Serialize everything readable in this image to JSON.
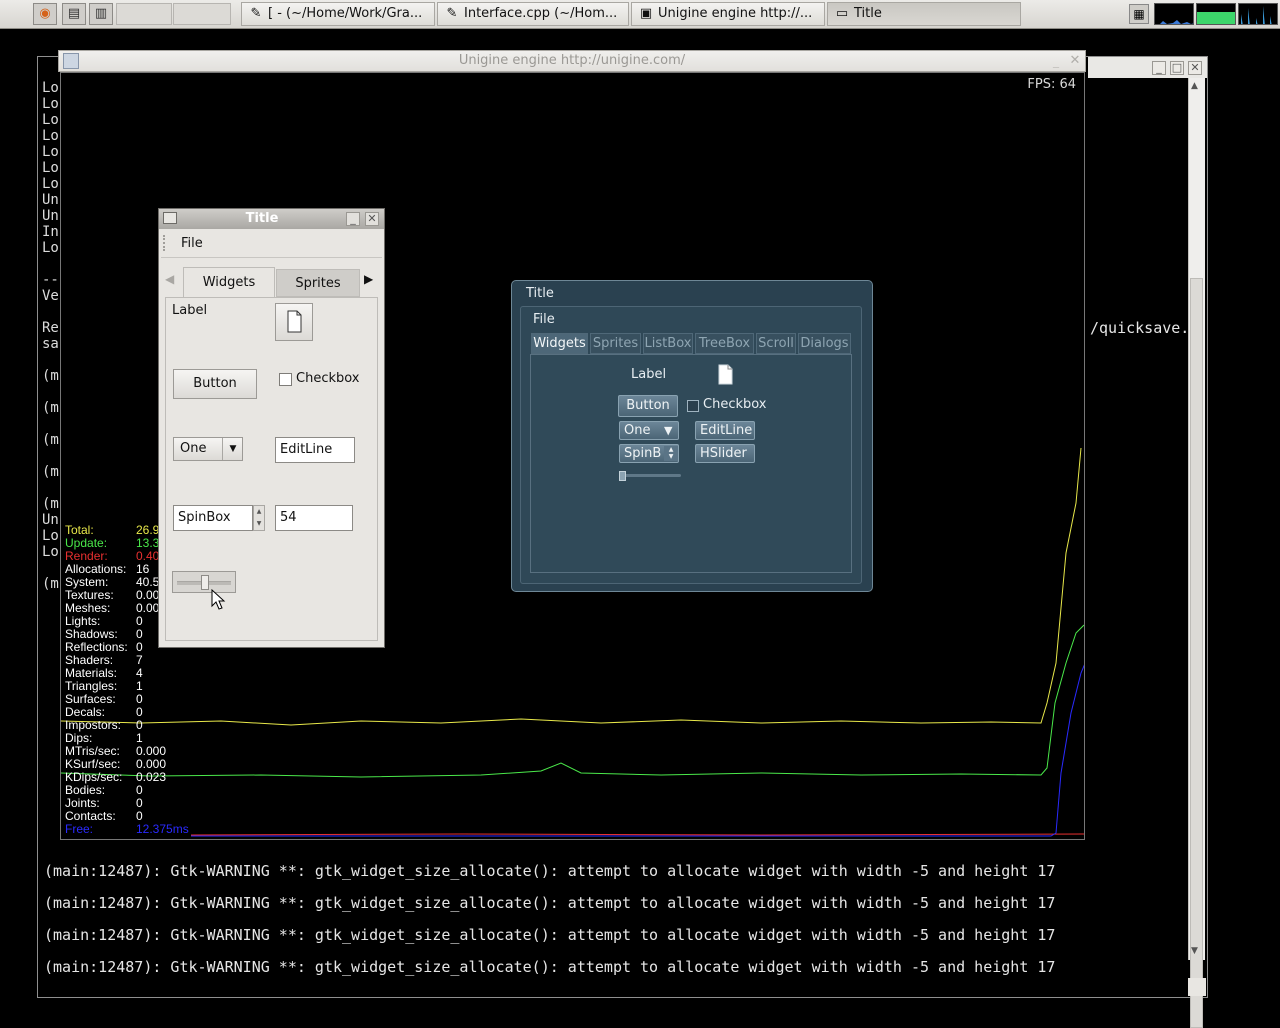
{
  "taskbar": {
    "launchers": [
      {
        "icon": "firefox-icon",
        "glyph": "◉"
      },
      {
        "icon": "terminal-icon",
        "glyph": "▤"
      },
      {
        "icon": "desktop-icon",
        "glyph": "▥"
      }
    ],
    "tasks": [
      {
        "label": "[ - (~/Home/Work/Gra...",
        "icon": "editor-icon",
        "glyph": "✎"
      },
      {
        "label": "Interface.cpp (~/Hom...",
        "icon": "editor-icon",
        "glyph": "✎"
      },
      {
        "label": "Unigine engine http://...",
        "icon": "window-icon",
        "glyph": "▣"
      },
      {
        "label": "Title",
        "icon": "window-icon",
        "glyph": "▭"
      }
    ]
  },
  "terminal": {
    "left_fragment": [
      "Lo",
      "Lo",
      "Lo",
      "Lo",
      "Lo",
      "Lo",
      "Lo",
      "Un",
      "Un",
      "In",
      "Lo",
      "",
      "--",
      "Ve",
      "",
      "Re",
      "sa",
      "",
      "(m",
      "",
      "(m",
      "",
      "(m",
      "",
      "(m",
      "",
      "(m",
      "Un",
      "Lo",
      "Lo",
      "",
      "(m"
    ],
    "right_fragment": "/quicksave.",
    "warning_lines": [
      "(main:12487): Gtk-WARNING **: gtk_widget_size_allocate(): attempt to allocate widget with width -5 and height 17",
      "(main:12487): Gtk-WARNING **: gtk_widget_size_allocate(): attempt to allocate widget with width -5 and height 17",
      "(main:12487): Gtk-WARNING **: gtk_widget_size_allocate(): attempt to allocate widget with width -5 and height 17",
      "(main:12487): Gtk-WARNING **: gtk_widget_size_allocate(): attempt to allocate widget with width -5 and height 17"
    ]
  },
  "unigine": {
    "window_title": "Unigine engine http://unigine.com/",
    "fps": "FPS: 64",
    "stats": [
      {
        "label": "Total:",
        "value": "26.9",
        "color": "#e8e84a"
      },
      {
        "label": "Update:",
        "value": "13.3",
        "color": "#4ae84a"
      },
      {
        "label": "Render:",
        "value": "0.40",
        "color": "#e83030"
      },
      {
        "label": "Allocations:",
        "value": "16",
        "color": "#ffffff"
      },
      {
        "label": "System:",
        "value": "40.5",
        "color": "#ffffff"
      },
      {
        "label": "Textures:",
        "value": "0.00",
        "color": "#ffffff"
      },
      {
        "label": "Meshes:",
        "value": "0.00",
        "color": "#ffffff"
      },
      {
        "label": "Lights:",
        "value": "0",
        "color": "#ffffff"
      },
      {
        "label": "Shadows:",
        "value": "0",
        "color": "#ffffff"
      },
      {
        "label": "Reflections:",
        "value": "0",
        "color": "#ffffff"
      },
      {
        "label": "Shaders:",
        "value": "7",
        "color": "#ffffff"
      },
      {
        "label": "Materials:",
        "value": "4",
        "color": "#ffffff"
      },
      {
        "label": "Triangles:",
        "value": "1",
        "color": "#ffffff"
      },
      {
        "label": "Surfaces:",
        "value": "0",
        "color": "#ffffff"
      },
      {
        "label": "Decals:",
        "value": "0",
        "color": "#ffffff"
      },
      {
        "label": "Impostors:",
        "value": "0",
        "color": "#ffffff"
      },
      {
        "label": "Dips:",
        "value": "1",
        "color": "#ffffff"
      },
      {
        "label": "MTris/sec:",
        "value": "0.000",
        "color": "#ffffff"
      },
      {
        "label": "KSurf/sec:",
        "value": "0.000",
        "color": "#ffffff"
      },
      {
        "label": "KDips/sec:",
        "value": "0.023",
        "color": "#ffffff"
      },
      {
        "label": "Bodies:",
        "value": "0",
        "color": "#ffffff"
      },
      {
        "label": "Joints:",
        "value": "0",
        "color": "#ffffff"
      },
      {
        "label": "Contacts:",
        "value": "0",
        "color": "#ffffff"
      },
      {
        "label": "Free:",
        "value": "12.375ms",
        "color": "#2a2aff"
      }
    ],
    "graph_colors": {
      "total": "#e8e84a",
      "update": "#4ae84a",
      "render": "#e83030",
      "free": "#2a2aff"
    }
  },
  "gtk_dialog": {
    "title": "Title",
    "menu_file": "File",
    "tabs": [
      "Widgets",
      "Sprites"
    ],
    "label": "Label",
    "button": "Button",
    "checkbox": "Checkbox",
    "combo": "One",
    "editline": "EditLine",
    "spinbox": "SpinBox",
    "spin_value": "54",
    "slider_value": 0.45
  },
  "unigine_dialog": {
    "title": "Title",
    "menu_file": "File",
    "tabs": [
      "Widgets",
      "Sprites",
      "ListBox",
      "TreeBox",
      "Scroll",
      "Dialogs"
    ],
    "label": "Label",
    "button": "Button",
    "checkbox": "Checkbox",
    "combo": "One",
    "editline": "EditLine",
    "spinbox": "SpinB",
    "hslider": "HSlider",
    "slider_value": 0.0
  }
}
